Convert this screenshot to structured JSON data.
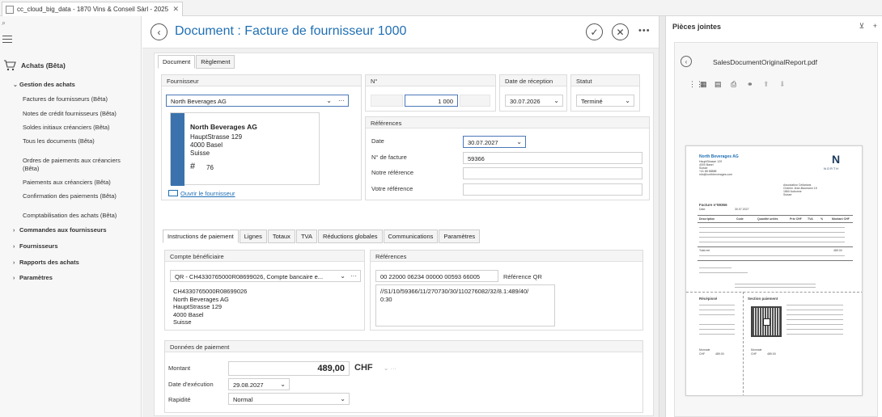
{
  "window": {
    "tab_title": "cc_cloud_big_data - 1870 Vins & Conseil Sàrl - 2025"
  },
  "sidebar": {
    "section": "Achats (Bêta)",
    "group": "Gestion des achats",
    "items": [
      "Factures de fournisseurs (Bêta)",
      "Notes de crédit fournisseurs (Bêta)",
      "Soldes initiaux créanciers (Bêta)",
      "Tous les documents (Bêta)",
      "Ordres de paiements aux créanciers",
      "(Bêta)",
      "Paiements aux créanciers (Bêta)",
      "Confirmation des paiements (Bêta)",
      "Comptabilisation des achats (Bêta)"
    ],
    "groups_collapsed": [
      "Commandes aux fournisseurs",
      "Fournisseurs",
      "Rapports des achats",
      "Paramètres"
    ]
  },
  "header": {
    "title": "Document : Facture de fournisseur 1000"
  },
  "tabs_top": [
    "Document",
    "Règlement"
  ],
  "supplier": {
    "group_title": "Fournisseur",
    "selected": "North Beverages AG",
    "card": {
      "name": "North Beverages AG",
      "street": "HauptStrasse 129",
      "city": "4000 Basel",
      "country": "Suisse",
      "number_prefix": "#",
      "number": "76"
    },
    "open_link": "Ouvrir le fournisseur"
  },
  "number_group": {
    "title": "N°",
    "value": "1 000"
  },
  "reception_group": {
    "title": "Date de réception",
    "value": "30.07.2026"
  },
  "status_group": {
    "title": "Statut",
    "value": "Terminé"
  },
  "references": {
    "title": "Références",
    "date_label": "Date",
    "date_value": "30.07.2027",
    "invoice_no_label": "N° de facture",
    "invoice_no_value": "59366",
    "our_ref_label": "Notre référence",
    "your_ref_label": "Votre référence"
  },
  "tabs_bottom": [
    "Instructions de paiement",
    "Lignes",
    "Totaux",
    "TVA",
    "Réductions globales",
    "Communications",
    "Paramètres"
  ],
  "beneficiary": {
    "title": "Compte bénéficiaire",
    "selected": "QR - CH4330765000R08699026, Compte bancaire e...",
    "lines": "CH4330765000R08699026\nNorth Beverages AG\nHauptStrasse 129\n4000 Basel\nSuisse"
  },
  "payment_refs": {
    "title": "Références",
    "qr_ref": "00 22000 06234 00000 00593 66005",
    "qr_ref_label": "Référence QR",
    "info": "//S1/10/59366/11/270730/30/110276082/32/8.1:489/40/\n0:30"
  },
  "payment_data": {
    "title": "Données de paiement",
    "amount_label": "Montant",
    "amount_value": "489,00",
    "currency": "CHF",
    "exec_date_label": "Date d'exécution",
    "exec_date_value": "29.08.2027",
    "speed_label": "Rapidité",
    "speed_value": "Normal"
  },
  "attachments": {
    "title": "Pièces jointes",
    "file_name": "SalesDocumentOriginalReport.pdf"
  },
  "pdf_preview": {
    "company": "North Beverages AG",
    "company_lines": [
      "HauptStrasse 129",
      "4000 Basel",
      "Suisse",
      "+41 88 88888",
      "info@northbeverages.com"
    ],
    "logo_text": "NORTH",
    "recipient": [
      "Association Cellarians",
      "Chemin Jean-Baumann 15",
      "1860 Aubonne",
      "Suisse"
    ],
    "doc_title": "Facture n°59366",
    "date_label": "Date",
    "date_value": "30.07.2027",
    "table_headers": [
      "Description",
      "Code",
      "Quantité unités",
      "Prix CHF",
      "TVA",
      "%",
      "Montant CHF"
    ],
    "total_label": "Total net",
    "total_value": "489.00",
    "receipt_label": "Récépissé",
    "payment_section_label": "Section paiement",
    "amount_label": "Monnaie",
    "currency": "CHF",
    "amount": "489.00"
  }
}
